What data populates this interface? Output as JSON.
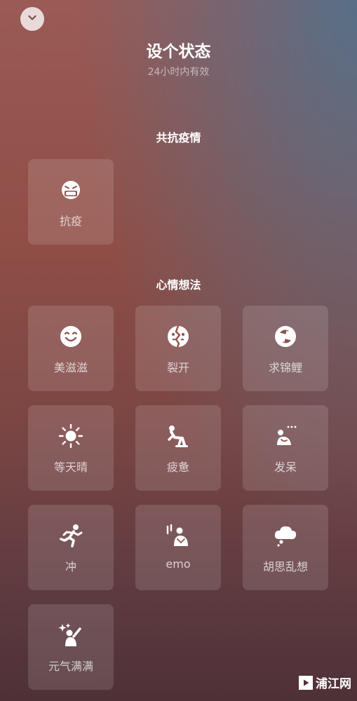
{
  "header": {
    "back_icon": "chevron-down-icon",
    "title": "设个状态",
    "subtitle": "24小时内有效"
  },
  "sections": [
    {
      "title": "共抗疫情",
      "items": [
        {
          "label": "抗疫",
          "icon": "mask-face-icon"
        }
      ]
    },
    {
      "title": "心情想法",
      "items": [
        {
          "label": "美滋滋",
          "icon": "smile-icon"
        },
        {
          "label": "裂开",
          "icon": "cracked-face-icon"
        },
        {
          "label": "求锦鲤",
          "icon": "koi-icon"
        },
        {
          "label": "等天晴",
          "icon": "sun-icon"
        },
        {
          "label": "疲惫",
          "icon": "tired-person-icon"
        },
        {
          "label": "发呆",
          "icon": "daze-person-icon"
        },
        {
          "label": "冲",
          "icon": "running-person-icon"
        },
        {
          "label": "emo",
          "icon": "emo-person-icon"
        },
        {
          "label": "胡思乱想",
          "icon": "thought-cloud-icon"
        },
        {
          "label": "元气满满",
          "icon": "energetic-person-icon"
        }
      ]
    }
  ],
  "watermark": {
    "text": "浦江网"
  },
  "colors": {
    "background_top": "#9a5a56",
    "background_bottom": "#4e3137",
    "accent_blue": "#54708a",
    "tile_background": "rgba(255,255,255,0.13)"
  }
}
